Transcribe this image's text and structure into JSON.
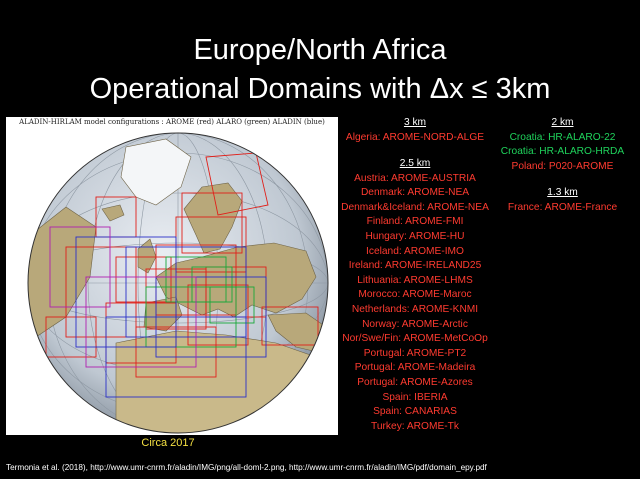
{
  "title": {
    "line1": "Europe/North Africa",
    "line2": "Operational Domains with Δx ≤ 3km"
  },
  "map": {
    "caption": "ALADIN-HIRLAM model configurations : AROME (red) ALARO (green) ALADIN (blue)",
    "circa": "Circa 2017",
    "colors": {
      "arome": "#e0201a",
      "alaro": "#18a83a",
      "aladin": "#2a30c8",
      "extra": "#b020b0"
    }
  },
  "sections": {
    "km3": {
      "header": "3 km",
      "entries": [
        "Algeria: AROME-NORD-ALGE"
      ]
    },
    "km2_5": {
      "header": "2.5 km",
      "entries": [
        "Austria: AROME-AUSTRIA",
        "Denmark: AROME-NEA",
        "Denmark&Iceland: AROME-NEA",
        "Finland: AROME-FMI",
        "Hungary: AROME-HU",
        "Iceland: AROME-IMO",
        "Ireland: AROME-IRELAND25",
        "Lithuania: AROME-LHMS",
        "Morocco: AROME-Maroc",
        "Netherlands: AROME-KNMI",
        "Norway: AROME-Arctic",
        "Nor/Swe/Fin: AROME-MetCoOp",
        "Portugal: AROME-PT2",
        "Portugal: AROME-Madeira",
        "Portugal: AROME-Azores",
        "Spain: IBERIA",
        "Spain: CANARIAS",
        "Turkey: AROME-Tk"
      ]
    },
    "km2": {
      "header": "2 km",
      "entries": [
        {
          "text": "Croatia: HR-ALARO-22",
          "color": "green"
        },
        {
          "text": "Croatia: HR-ALARO-HRDA",
          "color": "green"
        },
        {
          "text": "Poland: P020-AROME",
          "color": "red"
        }
      ]
    },
    "km1_3": {
      "header": "1.3 km",
      "entries": [
        "France: AROME-France"
      ]
    }
  },
  "citation": "Termonia et al. (2018), http://www.umr-cnrm.fr/aladin/IMG/png/all-doml-2.png, http://www.umr-cnrm.fr/aladin/IMG/pdf/domain_epy.pdf"
}
